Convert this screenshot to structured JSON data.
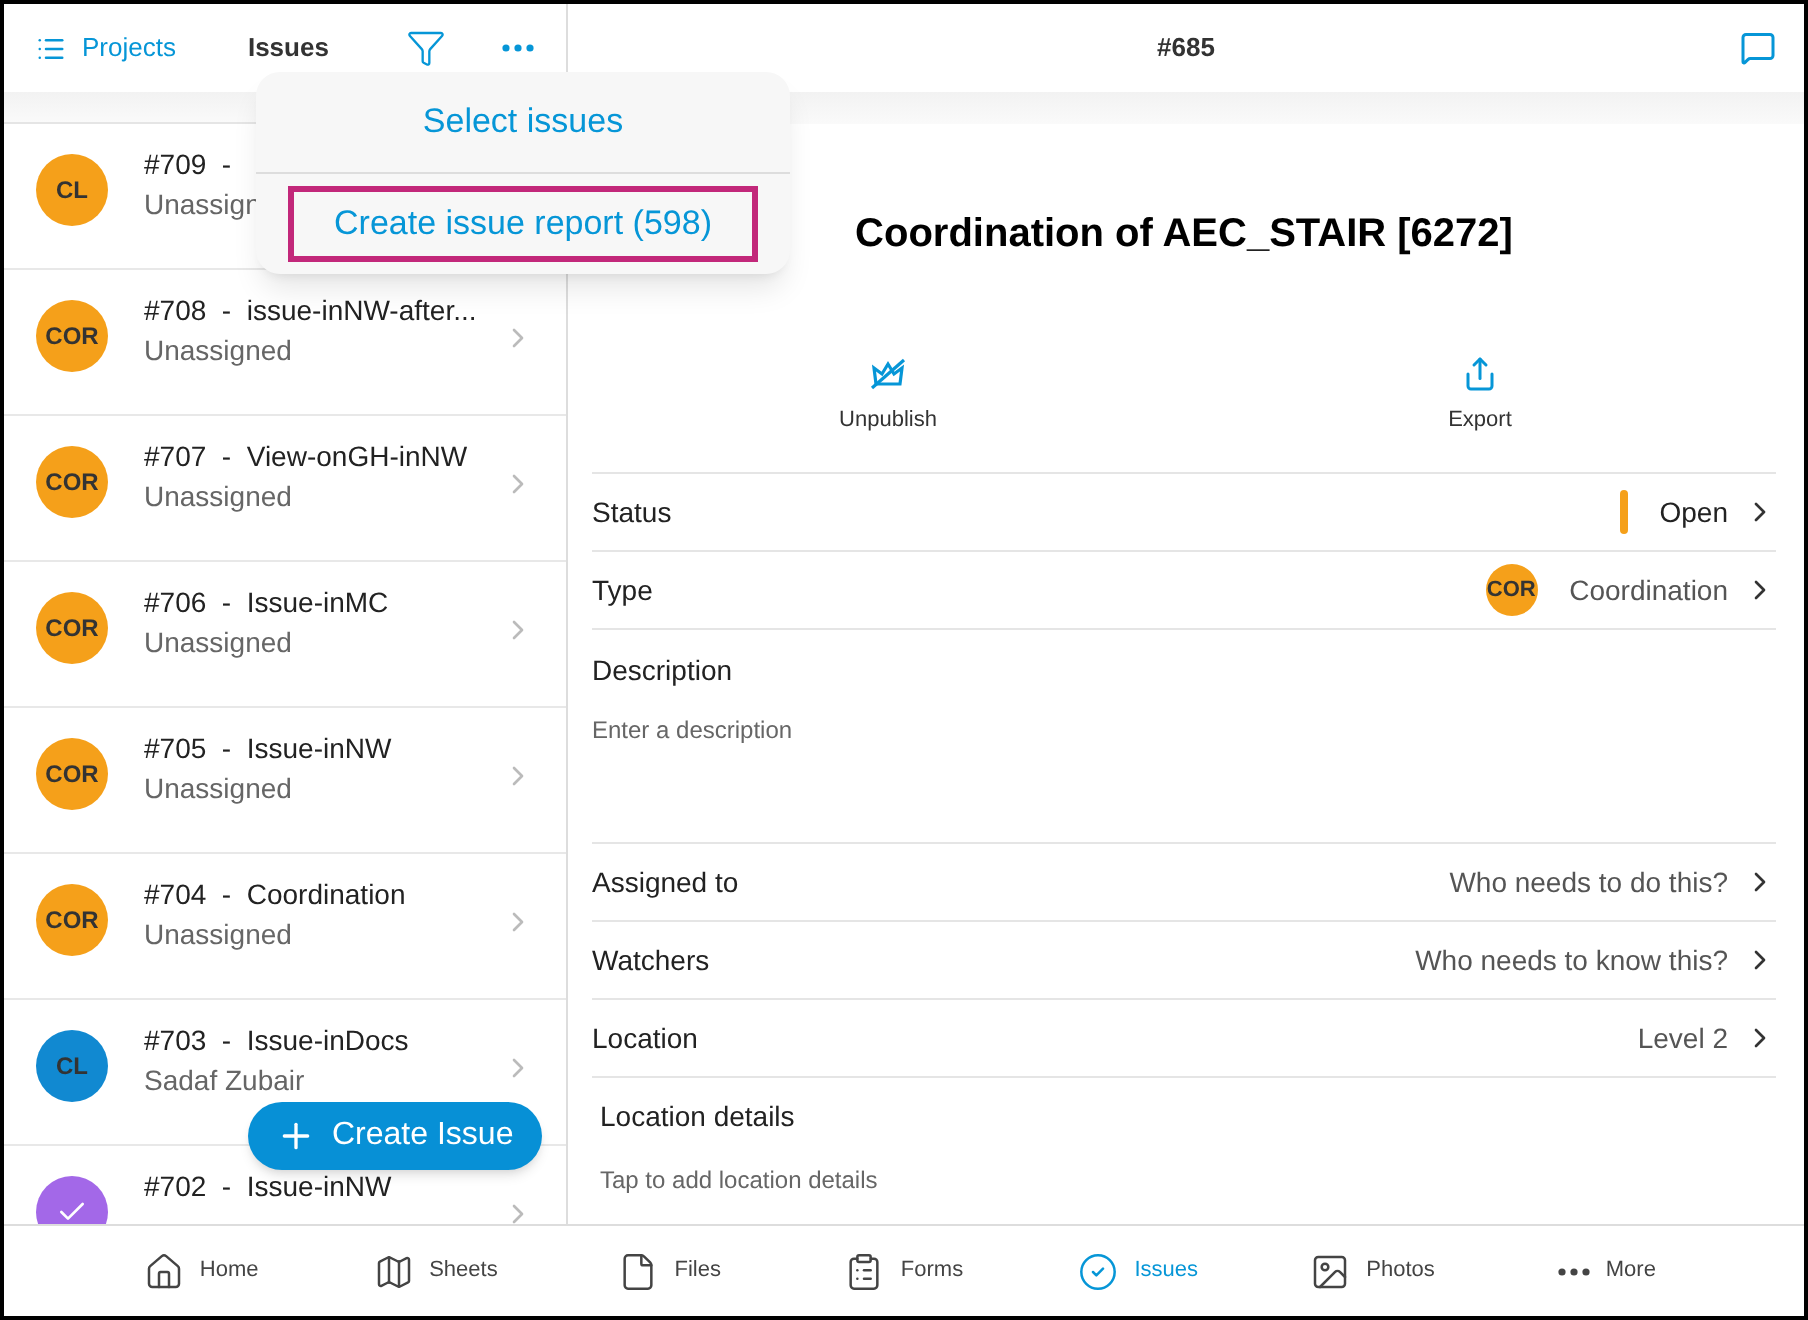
{
  "sidebar": {
    "projects_link": "Projects",
    "title": "Issues",
    "issues": [
      {
        "title": "#709  -",
        "assignee": "Unassign",
        "avatar": {
          "kind": "initials",
          "text": "CL",
          "color": "#f5a01a"
        }
      },
      {
        "title": "#708  -  issue-inNW-after...",
        "assignee": "Unassigned",
        "chevron": true,
        "avatar": {
          "kind": "initials",
          "text": "COR",
          "color": "#f5a01a"
        }
      },
      {
        "title": "#707  -  View-onGH-inNW",
        "assignee": "Unassigned",
        "chevron": true,
        "avatar": {
          "kind": "initials",
          "text": "COR",
          "color": "#f5a01a"
        }
      },
      {
        "title": "#706  -  Issue-inMC",
        "assignee": "Unassigned",
        "chevron": true,
        "avatar": {
          "kind": "initials",
          "text": "COR",
          "color": "#f5a01a"
        }
      },
      {
        "title": "#705  -  Issue-inNW",
        "assignee": "Unassigned",
        "chevron": true,
        "avatar": {
          "kind": "initials",
          "text": "COR",
          "color": "#f5a01a"
        }
      },
      {
        "title": "#704  -  Coordination",
        "assignee": "Unassigned",
        "chevron": true,
        "avatar": {
          "kind": "initials",
          "text": "COR",
          "color": "#f5a01a"
        }
      },
      {
        "title": "#703  -  Issue-inDocs",
        "assignee": "Sadaf Zubair",
        "chevron": true,
        "avatar": {
          "kind": "initials",
          "text": "CL",
          "color": "#1189d1"
        }
      },
      {
        "title": "#702  -  Issue-inNW",
        "chevron": true,
        "avatar": {
          "kind": "check",
          "color": "#a368e8"
        }
      }
    ]
  },
  "menu": {
    "items": [
      {
        "label": "Select issues",
        "highlighted": false
      },
      {
        "label": "Create issue report (598)",
        "highlighted": true
      }
    ]
  },
  "create_button": "Create Issue",
  "detail": {
    "number": "#685",
    "title": "Coordination of AEC_STAIR [6272]",
    "actions": [
      {
        "kind": "unpublish",
        "label": "Unpublish"
      },
      {
        "kind": "export",
        "label": "Export"
      }
    ],
    "fields": [
      {
        "kind": "status",
        "label": "Status",
        "value": "Open",
        "color": "#f5a01a"
      },
      {
        "kind": "type",
        "label": "Type",
        "value": "Coordination",
        "badge": "COR",
        "color": "#f5a01a"
      },
      {
        "kind": "multiline",
        "label": "Description",
        "placeholder": "Enter a description"
      },
      {
        "kind": "picker",
        "label": "Assigned to",
        "value": "Who needs to do this?"
      },
      {
        "kind": "picker",
        "label": "Watchers",
        "value": "Who needs to know this?"
      },
      {
        "kind": "picker",
        "label": "Location",
        "value": "Level 2"
      },
      {
        "kind": "details",
        "label": "Location details",
        "placeholder": "Tap to add location details"
      }
    ]
  },
  "tabs": [
    {
      "kind": "home",
      "label": "Home",
      "selected": false
    },
    {
      "kind": "sheets",
      "label": "Sheets",
      "selected": false
    },
    {
      "kind": "files",
      "label": "Files",
      "selected": false
    },
    {
      "kind": "forms",
      "label": "Forms",
      "selected": false
    },
    {
      "kind": "issues",
      "label": "Issues",
      "selected": true
    },
    {
      "kind": "photos",
      "label": "Photos",
      "selected": false
    },
    {
      "kind": "more",
      "label": "More",
      "selected": false
    }
  ]
}
